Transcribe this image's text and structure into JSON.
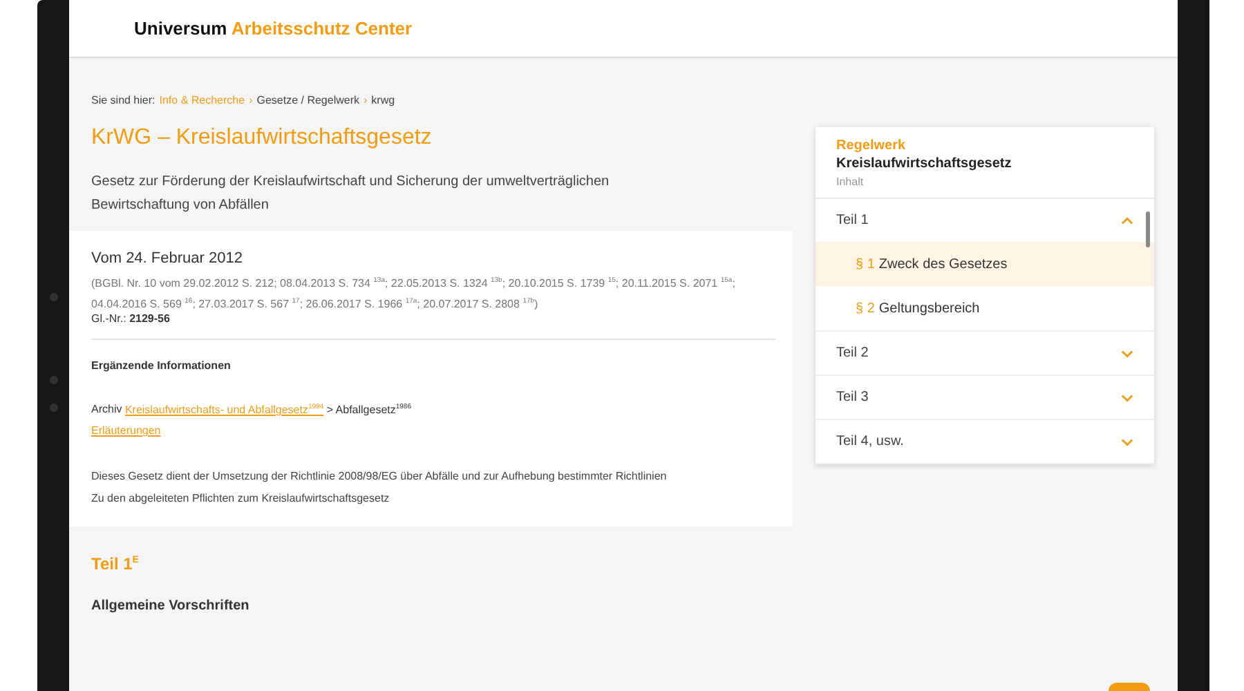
{
  "header": {
    "brand": "Universum",
    "brand_accent": "Arbeitsschutz Center"
  },
  "breadcrumb": {
    "prefix": "Sie sind hier:",
    "separator": "›",
    "items": [
      {
        "label": "Info & Recherche",
        "kind": "link"
      },
      {
        "label": "Gesetze / Regelwerk",
        "kind": "text"
      },
      {
        "label": "krwg",
        "kind": "text"
      }
    ]
  },
  "title": "KrWG – Kreislaufwirtschaftsgesetz",
  "subtitle": "Gesetz zur Förderung der Kreislaufwirtschaft und Sicherung der umweltverträglichen Bewirtschaftung von Abfällen",
  "card": {
    "date": "Vom 24. Februar 2012",
    "sources": "(BGBl. Nr. 10 vom 29.02.2012 S. 212; 08.04.2013 S. 734 $^{13a}$; 22.05.2013 S. 1324 $^{13b}$; 20.10.2015 S. 1739 $^{15}$; 20.11.2015 S. 2071 $^{15a}$; 04.04.2016 S. 569 $^{16}$; 27.03.2017 S. 567 $^{17}$; 26.06.2017 S. 1966 $^{17a}$; 20.07.2017 S. 2808 $^{17b}$)",
    "gl_label": "Gl.-Nr.:",
    "gl_value": "2129-56",
    "info_heading": "Ergänzende Informationen",
    "archive": {
      "prefix": "Archiv",
      "link": "Kreislaufwirtschafts- und Abfallgesetz",
      "link_sup": "1994",
      "suffix": "> Abfallgesetz$^{1986}$"
    },
    "explanations_link": "Erläuterungen",
    "paragraphs": [
      "Dieses Gesetz dient der Umsetzung der Richtlinie 2008/98/EG über Abfälle und zur Aufhebung bestimmter Richtlinien",
      "Zu den abgeleiteten Pflichten zum Kreislaufwirtschaftsgesetz"
    ]
  },
  "section": {
    "title": "Teil 1$^{E}$",
    "subtitle": "Allgemeine Vorschriften"
  },
  "sidebar": {
    "kicker": "Regelwerk",
    "title": "Kreislaufwirtschaftsgesetz",
    "caption": "Inhalt",
    "items": [
      {
        "label": "Teil 1",
        "expanded": true,
        "children": [
          {
            "number": "§ 1",
            "label": "Zweck des Gesetzes",
            "selected": true
          },
          {
            "number": "§ 2",
            "label": "Geltungsbereich",
            "selected": false
          }
        ]
      },
      {
        "label": "Teil 2",
        "expanded": false
      },
      {
        "label": "Teil 3",
        "expanded": false
      },
      {
        "label": "Teil 4, usw.",
        "expanded": false
      }
    ]
  }
}
